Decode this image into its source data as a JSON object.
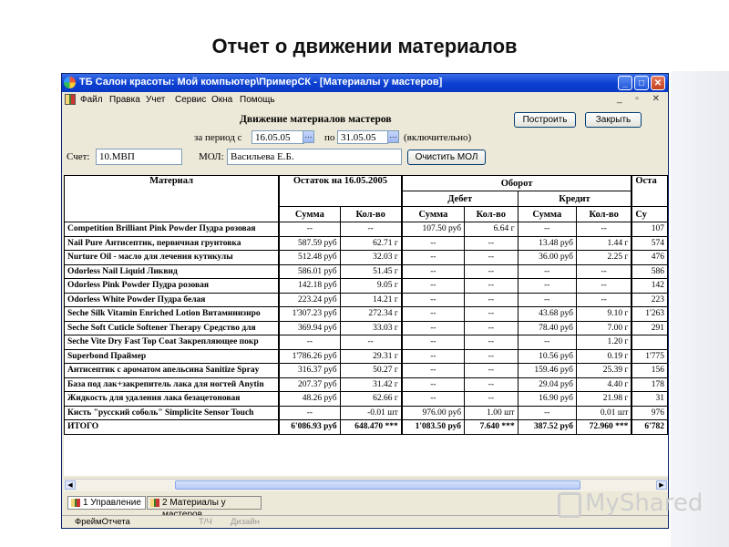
{
  "slide": {
    "title": "Отчет о движении материалов"
  },
  "window": {
    "title": "ТБ Салон красоты: Мой компьютер\\ПримерСК - [Материалы у мастеров]",
    "controls": {
      "minimize": "_",
      "maximize": "□",
      "close": "✕"
    }
  },
  "menu": {
    "items": [
      "Файл",
      "Правка",
      "Учет",
      "Сервис",
      "Окна",
      "Помощь"
    ],
    "mdi": "_ ▫ ✕"
  },
  "report": {
    "heading": "Движение материалов мастеров",
    "period_label": "за период с",
    "date_from": "16.05.05",
    "to_label": "по",
    "date_to": "31.05.05",
    "inclusive": "(включительно)",
    "build_button": "Построить",
    "close_button": "Закрыть",
    "account_label": "Счет:",
    "account_value": "10.МВП",
    "mol_label": "МОЛ:",
    "mol_value": "Васильева Е.Б.",
    "clear_mol_button": "Очистить МОЛ",
    "dd": "…"
  },
  "table": {
    "header": {
      "material": "Материал",
      "balance": "Остаток на 16.05.2005",
      "turnover": "Оборот",
      "debit": "Дебет",
      "credit": "Кредит",
      "next": "Оста",
      "sum": "Сумма",
      "qty": "Кол-во",
      "next_sum": "Су"
    },
    "rows": [
      [
        "Competition Brilliant Pink Powder Пудра розовая",
        "--",
        "--",
        "107.50  руб",
        "6.64  г",
        "--",
        "--",
        "107"
      ],
      [
        "Nail Pure Антисептик, первичная грунтовка",
        "587.59  руб",
        "62.71  г",
        "--",
        "--",
        "13.48  руб",
        "1.44  г",
        "574"
      ],
      [
        "Nurture Oil - масло для лечения кутикулы",
        "512.48  руб",
        "32.03  г",
        "--",
        "--",
        "36.00  руб",
        "2.25  г",
        "476"
      ],
      [
        "Odorless Nail  Liquid Ликвид",
        "586.01  руб",
        "51.45  г",
        "--",
        "--",
        "--",
        "--",
        "586"
      ],
      [
        "Odorless Pink  Powder Пудра розовая",
        "142.18  руб",
        "9.05  г",
        "--",
        "--",
        "--",
        "--",
        "142"
      ],
      [
        "Odorless White Powder Пудра белая",
        "223.24  руб",
        "14.21  г",
        "--",
        "--",
        "--",
        "--",
        "223"
      ],
      [
        "Seche Silk Vitamin Enriched Lotion Витаминизиро",
        "1'307.23  руб",
        "272.34  г",
        "--",
        "--",
        "43.68  руб",
        "9.10  г",
        "1'263"
      ],
      [
        "Seche Soft Cuticle Softener Therapy Средство для",
        "369.94  руб",
        "33.03  г",
        "--",
        "--",
        "78.40  руб",
        "7.00  г",
        "291"
      ],
      [
        "Seche Vite Dry Fast Top Coat  Закрепляющее покр",
        "--",
        "--",
        "--",
        "--",
        "--",
        "1.20  г",
        ""
      ],
      [
        "Superbond  Праймер",
        "1'786.26  руб",
        "29.31  г",
        "--",
        "--",
        "10.56  руб",
        "0.19  г",
        "1'775"
      ],
      [
        "Антисептик с ароматом апельсина Sanitize Spray",
        "316.37  руб",
        "50.27  г",
        "--",
        "--",
        "159.46  руб",
        "25.39  г",
        "156"
      ],
      [
        "База под лак+закрепитель лака для ногтей Anytin",
        "207.37  руб",
        "31.42  г",
        "--",
        "--",
        "29.04  руб",
        "4.40  г",
        "178"
      ],
      [
        "Жидкость для удаления лака безацетоновая",
        "48.26  руб",
        "62.66  г",
        "--",
        "--",
        "16.90  руб",
        "21.98  г",
        "31"
      ],
      [
        "Кисть \"русский соболь\" Simplicite Sensor Touch",
        "--",
        "-0.01  шт",
        "976.00  руб",
        "1.00  шт",
        "--",
        "0.01  шт",
        "976"
      ]
    ],
    "total": [
      "ИТОГО",
      "6'086.93  руб",
      "648.470  ***",
      "1'083.50  руб",
      "7.640  ***",
      "387.52  руб",
      "72.960  ***",
      "6'782"
    ]
  },
  "tabs": [
    "1 Управление",
    "2 Материалы у мастеров"
  ],
  "status": [
    "ФреймОтчета",
    "Т/Ч",
    "Дизайн"
  ],
  "watermark": "MyShared"
}
